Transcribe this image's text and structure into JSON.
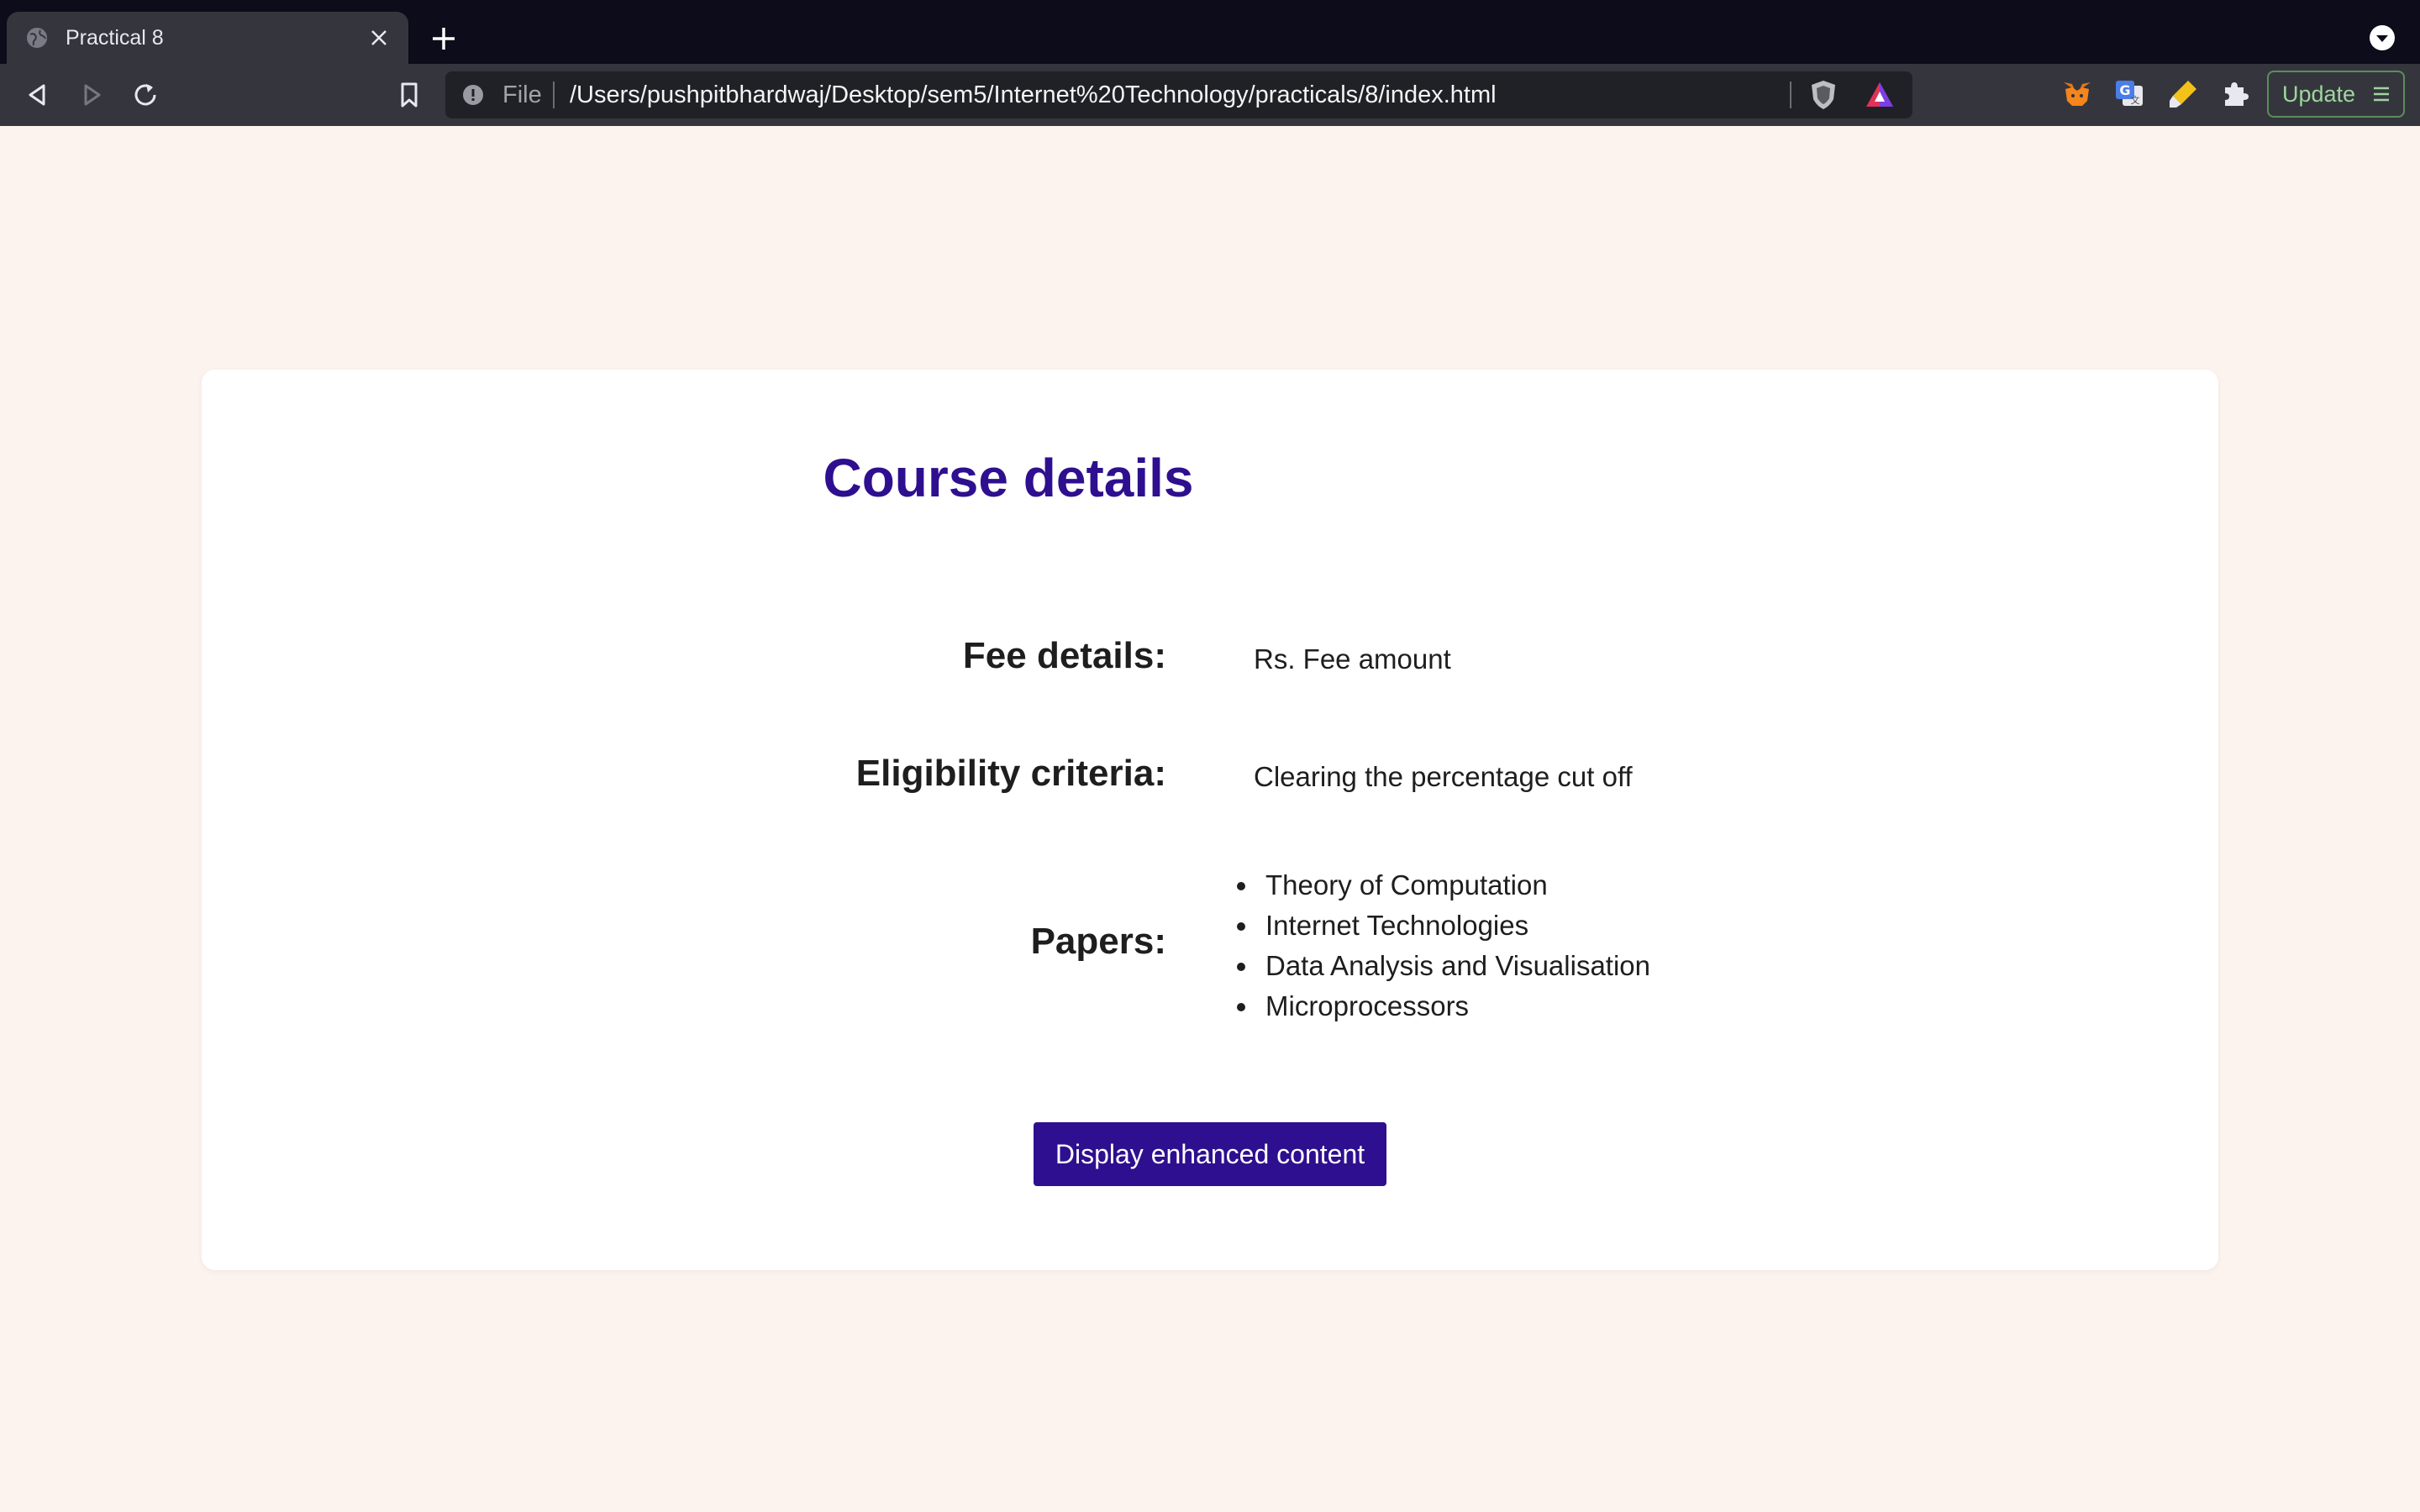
{
  "browser": {
    "tab": {
      "title": "Practical 8",
      "favicon": "globe-icon",
      "close_icon": "close-icon"
    },
    "new_tab_icon": "plus-icon",
    "tab_menu_icon": "chevron-down-circle-icon",
    "toolbar": {
      "back_icon": "back-arrow-icon",
      "forward_icon": "forward-arrow-icon",
      "reload_icon": "reload-icon",
      "bookmark_icon": "bookmark-icon"
    },
    "omnibox": {
      "scheme_label": "File",
      "url": "/Users/pushpitbhardwaj/Desktop/sem5/Internet%20Technology/practicals/8/index.html",
      "info_icon": "info-icon",
      "shield_icon": "brave-shield-icon",
      "rewards_icon": "brave-rewards-icon"
    },
    "extensions": [
      "metamask-icon",
      "google-translate-icon",
      "highlighter-icon",
      "puzzle-icon"
    ],
    "update_label": "Update"
  },
  "page": {
    "title": "Course details",
    "rows": [
      {
        "label": "Fee details:",
        "value": "Rs. Fee amount"
      },
      {
        "label": "Eligibility criteria:",
        "value": "Clearing the percentage cut off"
      },
      {
        "label": "Papers:"
      }
    ],
    "papers": [
      "Theory of Computation",
      "Internet Technologies",
      "Data Analysis and Visualisation",
      "Microprocessors"
    ],
    "button_label": "Display enhanced content"
  },
  "colors": {
    "page_background": "#fcf3ee",
    "accent": "#2e0f8f",
    "tab_strip": "#0c0c1a",
    "toolbar": "#35363d"
  }
}
